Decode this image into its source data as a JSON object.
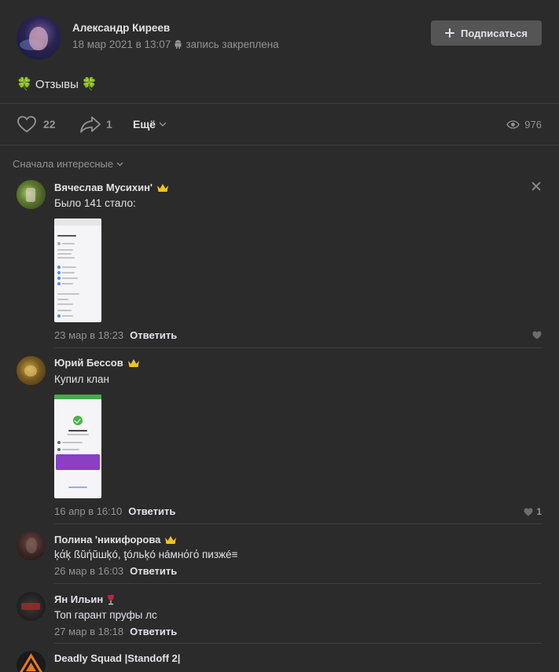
{
  "post": {
    "author_name": "Александр Киреев",
    "date": "18 мар 2021 в 13:07",
    "pinned_label": "запись закреплена",
    "subscribe_label": "Подписаться",
    "text": "Отзывы",
    "text_emoji": "🍀",
    "likes": "22",
    "shares": "1",
    "more_label": "Ещё",
    "views": "976"
  },
  "comments_sort": {
    "label": "Сначала интересные"
  },
  "comments": [
    {
      "name": "Вячеслав Мусихин'",
      "text": "Было 141 стало:",
      "date": "23 мар в 18:23",
      "reply": "Ответить",
      "likes": ""
    },
    {
      "name": "Юрий Бессов",
      "text": "Купил клан",
      "date": "16 апр в 16:10",
      "reply": "Ответить",
      "likes": "1"
    },
    {
      "name": "Полина 'никифорова",
      "text": "ķάķ ßŭήŭшķó, ţóльķó нáмнόгό пизжé≡",
      "date": "26 мар в 16:03",
      "reply": "Ответить",
      "likes": ""
    },
    {
      "name": "Ян Ильин",
      "text": "Топ гарант пруфы лс",
      "date": "27 мар в 18:18",
      "reply": "Ответить",
      "likes": ""
    },
    {
      "name": "Deadly Squad |Standoff 2|",
      "text": "",
      "date": "",
      "reply": "",
      "likes": ""
    }
  ],
  "colors": {
    "background": "#2b2b2c",
    "accent_text": "#e1e3e6",
    "muted": "#939393",
    "button": "#555555",
    "crown": "#f0c419",
    "clover": "#4cc24a"
  }
}
